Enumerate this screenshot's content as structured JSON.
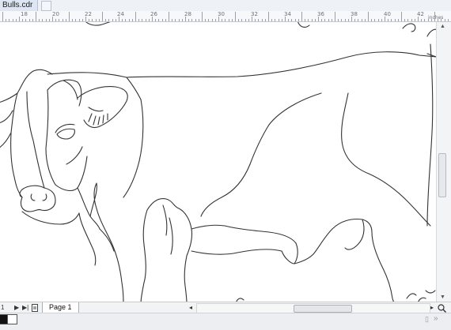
{
  "document_tab": {
    "title": "Bulls.cdr"
  },
  "ruler": {
    "labels": [
      "18",
      "20",
      "22",
      "24",
      "26",
      "28",
      "30",
      "32",
      "34",
      "36",
      "38",
      "40",
      "42"
    ],
    "unit": "inches"
  },
  "page_navigation": {
    "page_number": "1",
    "page_tab_label": "Page 1"
  },
  "colors": {
    "canvas_bg": "#ffffff",
    "outline": "#333333",
    "fill_swatch": "#111111",
    "outline_swatch": "#ffffff"
  },
  "icons": [
    "add-page-icon",
    "zoom-icon",
    "expand-icon",
    "scroll-arrow-icon",
    "first-page-icon",
    "next-page-icon",
    "last-page-icon"
  ]
}
